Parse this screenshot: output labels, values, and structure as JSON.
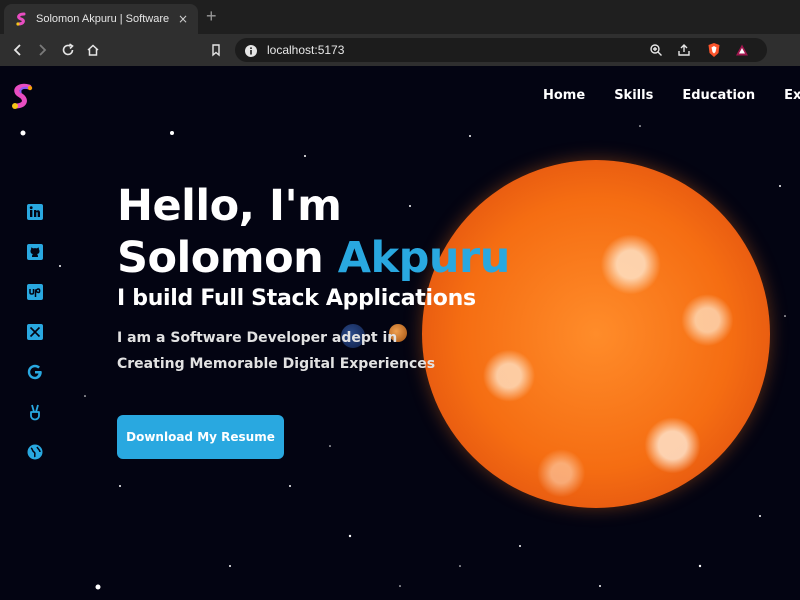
{
  "browser": {
    "tab_title": "Solomon Akpuru | Software Eng",
    "tab_close": "×",
    "new_tab": "+",
    "url": "localhost:5173"
  },
  "nav": {
    "items": [
      "Home",
      "Skills",
      "Education",
      "Exper"
    ]
  },
  "hero": {
    "line1": "Hello, I'm",
    "first_name": "Solomon",
    "last_name": "Akpuru",
    "subtitle": "I build Full Stack Applications",
    "desc1": "I am a Software Developer adept in",
    "desc2": "Creating Memorable Digital Experiences",
    "button": "Download My Resume"
  },
  "socials": [
    "linkedin-icon",
    "github-icon",
    "upwork-icon",
    "x-icon",
    "google-icon",
    "peace-icon",
    "globe-icon"
  ],
  "colors": {
    "accent": "#29a8e0",
    "background": "#030412",
    "sun": "#f56d12"
  }
}
